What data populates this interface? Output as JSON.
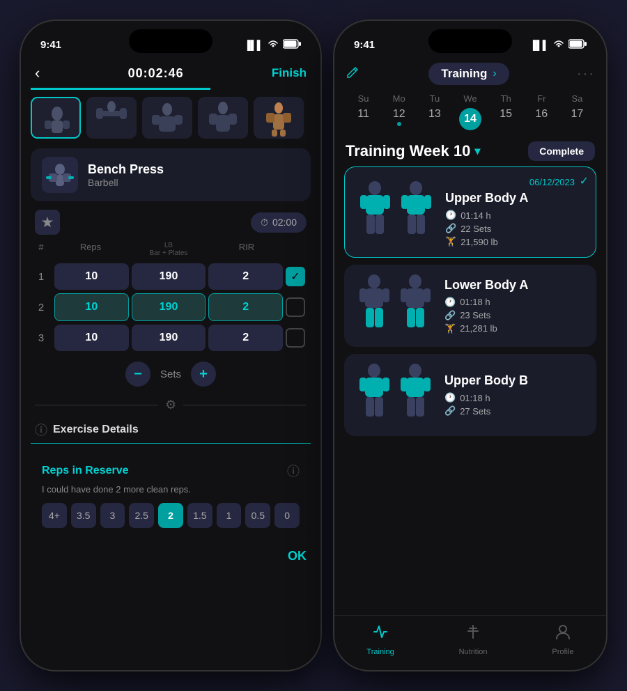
{
  "left_phone": {
    "status_bar": {
      "time": "9:41",
      "signal": "▐▐▐",
      "wifi": "WiFi",
      "battery": "🔋"
    },
    "header": {
      "back": "‹",
      "timer": "00:02:46",
      "finish": "Finish"
    },
    "exercise": {
      "name": "Bench Press",
      "type": "Barbell",
      "rest_timer": "02:00"
    },
    "sets_header": {
      "col1": "#",
      "col2": "Reps",
      "col3": "LB",
      "col3_sub": "Bar + Plates",
      "col4": "RIR"
    },
    "sets": [
      {
        "num": 1,
        "reps": 10,
        "weight": 190,
        "rir": 2,
        "done": true,
        "active": false
      },
      {
        "num": 2,
        "reps": 10,
        "weight": 190,
        "rir": 2,
        "done": false,
        "active": true
      },
      {
        "num": 3,
        "reps": 10,
        "weight": 190,
        "rir": 2,
        "done": false,
        "active": false
      }
    ],
    "sets_control": {
      "label": "Sets"
    },
    "exercise_details_label": "Exercise Details",
    "rir_section": {
      "title": "Reps in Reserve",
      "description": "I could have done 2 more clean reps.",
      "options": [
        "4+",
        "3.5",
        "3",
        "2.5",
        "2",
        "1.5",
        "1",
        "0.5",
        "0"
      ],
      "active": "2"
    },
    "ok_label": "OK"
  },
  "right_phone": {
    "status_bar": {
      "time": "9:41"
    },
    "header": {
      "title": "Training",
      "more": "···"
    },
    "calendar": {
      "day_names": [
        "Su",
        "Mo",
        "Tu",
        "We",
        "Th",
        "Fr",
        "Sa"
      ],
      "days": [
        "11",
        "12",
        "13",
        "14",
        "15",
        "16",
        "17"
      ],
      "active_day": "14",
      "dot_day": "12"
    },
    "week_title": "Training Week 10",
    "complete_label": "Complete",
    "workouts": [
      {
        "name": "Upper Body A",
        "date": "06/12/2023",
        "active": true,
        "duration": "01:14 h",
        "sets": "22 Sets",
        "weight": "21,590 lb"
      },
      {
        "name": "Lower Body A",
        "date": "",
        "active": false,
        "duration": "01:18 h",
        "sets": "23 Sets",
        "weight": "21,281 lb"
      },
      {
        "name": "Upper Body B",
        "date": "",
        "active": false,
        "duration": "01:18 h",
        "sets": "27 Sets",
        "weight": ""
      }
    ],
    "bottom_nav": [
      {
        "icon": "training",
        "label": "Training",
        "active": true
      },
      {
        "icon": "nutrition",
        "label": "Nutrition",
        "active": false
      },
      {
        "icon": "profile",
        "label": "Profile",
        "active": false
      }
    ]
  }
}
